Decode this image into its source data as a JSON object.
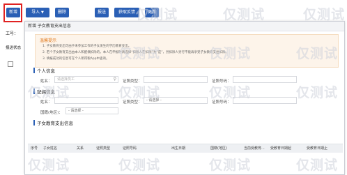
{
  "toolbar": {
    "new": "新增",
    "import": "导入",
    "delete": "删除",
    "submit": "报送",
    "feedback": "获取反馈",
    "update": "更新"
  },
  "background": {
    "work_id_label": "工号：",
    "status_label": "报送状态"
  },
  "modal": {
    "title": "新增 子女教育支出信息",
    "tips": {
      "title": "温馨提示",
      "lines": [
        "1. 子女教育支出可由于未参加工作的子女发生的学历教育支出。",
        "2. 若个子女教育支出由本人和配偶扣除的，本人在申报时请选择“扣除人在扣除”为“是”，另扣除人另行不能再享受子女教育支出扣除。",
        "3. 填报成功的信息可在个人所得税App中查询。"
      ]
    },
    "personal": {
      "title": "个人信息",
      "name_label": "姓名：",
      "name_placeholder": "请选择员工",
      "id_type_label": "证照类型：",
      "id_no_label": "证照号码："
    },
    "spouse": {
      "title": "配偶信息",
      "name_label": "姓名：",
      "id_type_label": "证照类型：",
      "id_type_value": "- 请选择 -",
      "id_no_label": "证照号码：",
      "nationality_label": "国籍(地区)：",
      "nationality_value": "- 请选择 -"
    },
    "child": {
      "title": "子女教育支出信息",
      "columns": [
        "序号",
        "子女姓名",
        "关系",
        "证照类型",
        "证照号码",
        "出生日期",
        "国籍(地区)",
        "当前受教育...",
        "受教育日期起",
        "受教育日期止"
      ]
    }
  },
  "watermark": "仅测试"
}
